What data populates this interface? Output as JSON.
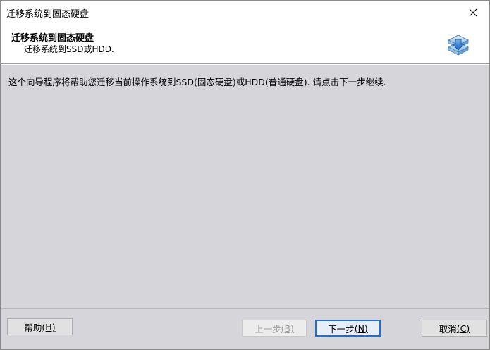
{
  "window": {
    "title": "迁移系统到固态硬盘"
  },
  "header": {
    "title": "迁移系统到固态硬盘",
    "subtitle": "迁移系统到SSD或HDD."
  },
  "body": {
    "description": "这个向导程序将帮助您迁移当前操作系统到SSD(固态硬盘)或HDD(普通硬盘). 请点击下一步继续."
  },
  "buttons": {
    "help": {
      "label": "帮助",
      "mnemonic": "(H)"
    },
    "back": {
      "label": "上一步",
      "mnemonic": "(B)"
    },
    "next": {
      "label": "下一步",
      "mnemonic": "(N)"
    },
    "cancel": {
      "label": "取消",
      "mnemonic": "(C)"
    }
  },
  "icons": {
    "close": "close-icon",
    "header": "disk-migrate-icon"
  },
  "colors": {
    "body_bg": "#d6d5da",
    "primary_border": "#1e6fd0"
  }
}
